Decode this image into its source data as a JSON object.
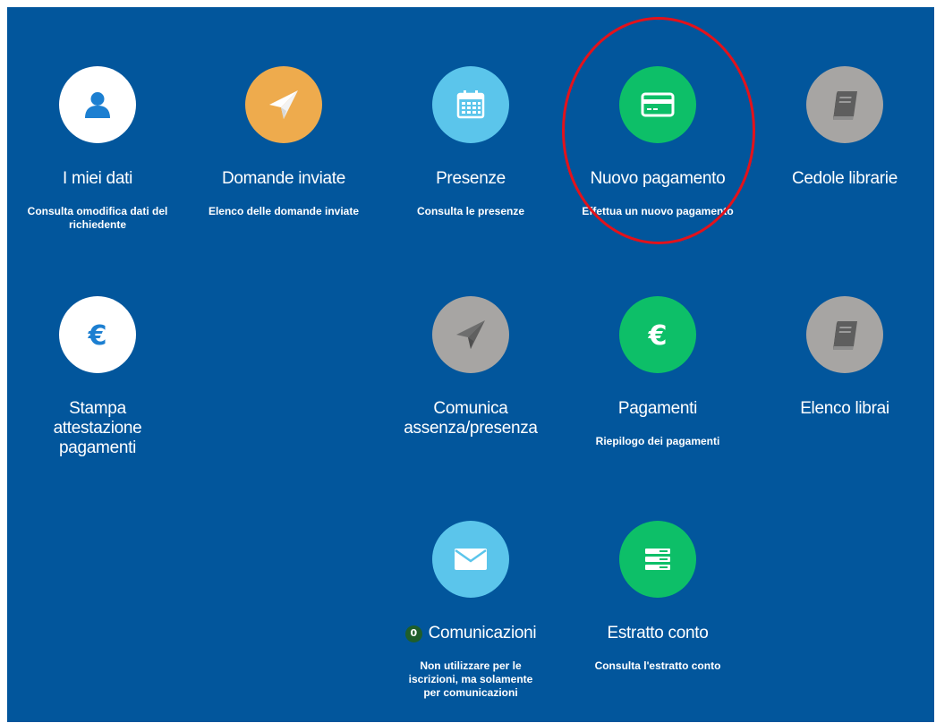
{
  "colors": {
    "background": "#02569c",
    "tile_white": "#ffffff",
    "tile_orange": "#eeab4d",
    "tile_sky": "#5bc5eb",
    "tile_green": "#0dbf68",
    "tile_grey": "#a7a5a3",
    "highlight": "#e3121b",
    "badge": "#1f5e2a"
  },
  "tiles": [
    {
      "id": "miei-dati",
      "title": "I miei dati",
      "description": "Consulta omodifica dati del richiedente",
      "icon": "user-icon",
      "color": "white"
    },
    {
      "id": "domande-inviate",
      "title": "Domande inviate",
      "description": "Elenco delle domande inviate",
      "icon": "paper-plane-icon",
      "color": "orange"
    },
    {
      "id": "presenze",
      "title": "Presenze",
      "description": "Consulta le presenze",
      "icon": "calendar-icon",
      "color": "sky"
    },
    {
      "id": "nuovo-pagamento",
      "title": "Nuovo pagamento",
      "description": "Effettua un nuovo pagamento",
      "icon": "credit-card-icon",
      "color": "green"
    },
    {
      "id": "cedole-librarie",
      "title": "Cedole librarie",
      "description": "",
      "icon": "book-icon",
      "color": "grey"
    },
    {
      "id": "stampa-attestazione",
      "title": "Stampa attestazione pagamenti",
      "description": "",
      "icon": "euro-icon",
      "color": "white"
    },
    {
      "id": "comunica-assenza",
      "title": "Comunica assenza/presenza",
      "description": "",
      "icon": "paper-plane-icon",
      "color": "grey"
    },
    {
      "id": "pagamenti",
      "title": "Pagamenti",
      "description": "Riepilogo dei pagamenti",
      "icon": "euro-icon",
      "color": "green"
    },
    {
      "id": "elenco-librai",
      "title": "Elenco librai",
      "description": "",
      "icon": "book-icon",
      "color": "grey"
    },
    {
      "id": "comunicazioni",
      "title": "Comunicazioni",
      "description": "Non utilizzare per le iscrizioni, ma solamente per comunicazioni",
      "icon": "envelope-icon",
      "color": "sky",
      "badge": "0"
    },
    {
      "id": "estratto-conto",
      "title": "Estratto conto",
      "description": "Consulta l'estratto conto",
      "icon": "list-icon",
      "color": "green"
    }
  ]
}
